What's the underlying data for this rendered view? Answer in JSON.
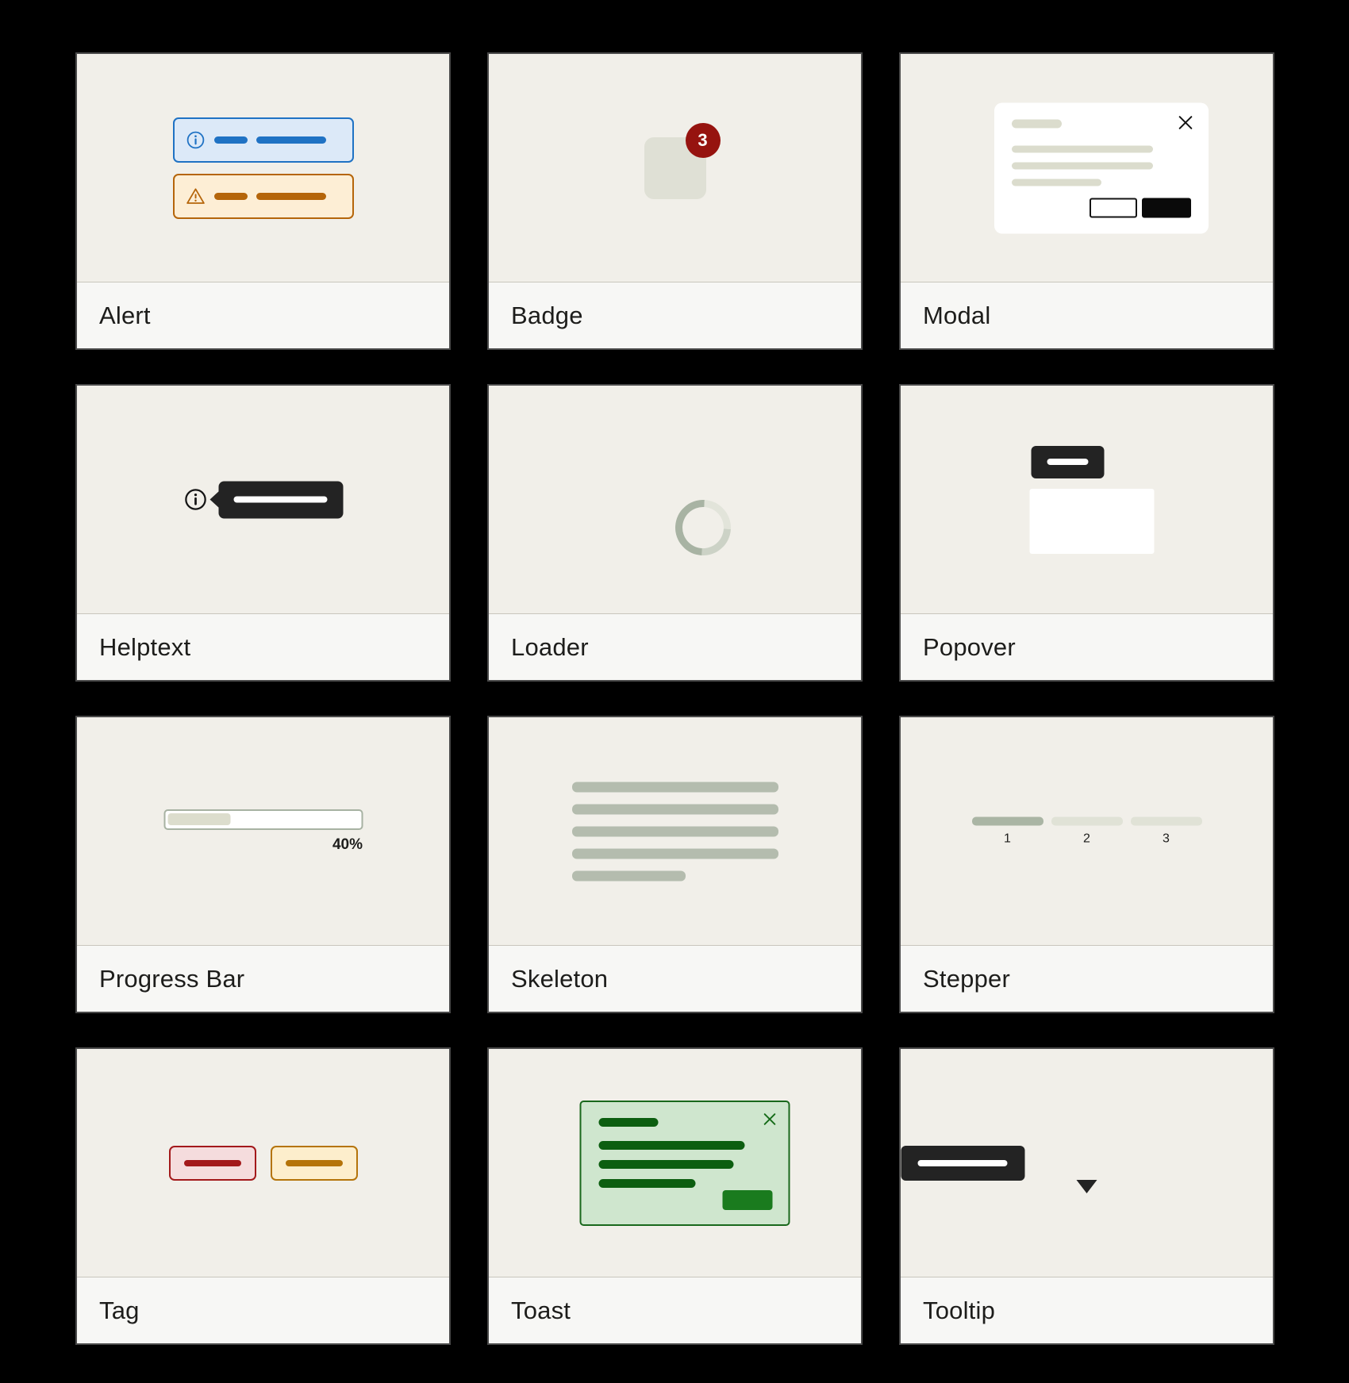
{
  "gallery": {
    "background_color": "#000000",
    "card_border_color": "#4a4a4a",
    "preview_background": "#f1efe9",
    "label_background": "#f7f7f5"
  },
  "cards": [
    {
      "id": "alert",
      "label": "Alert",
      "alerts": [
        {
          "variant": "info",
          "icon": "info-circle-icon",
          "accent": "#1f72c4",
          "fill": "#dce9f8",
          "bars": [
            "short",
            "long"
          ]
        },
        {
          "variant": "warning",
          "icon": "warning-triangle-icon",
          "accent": "#b5650a",
          "fill": "#fdeed5",
          "bars": [
            "short",
            "long"
          ]
        }
      ]
    },
    {
      "id": "badge",
      "label": "Badge",
      "badge": {
        "count": "3",
        "badge_color": "#96130f",
        "badge_text_color": "#ffffff",
        "square_color": "#dfe0d5"
      }
    },
    {
      "id": "modal",
      "label": "Modal",
      "modal": {
        "close_icon": "close-x-icon",
        "panel_color": "#ffffff",
        "skeleton_color": "#dbdccd",
        "buttons": [
          {
            "name": "secondary",
            "style": "outline",
            "color": "#141414"
          },
          {
            "name": "primary",
            "style": "filled",
            "color": "#0a0a0a"
          }
        ]
      }
    },
    {
      "id": "helptext",
      "label": "Helptext",
      "helptext": {
        "icon": "info-circle-icon",
        "bubble_color": "#232323",
        "bar_color": "#ffffff",
        "arrow_direction": "left"
      }
    },
    {
      "id": "loader",
      "label": "Loader",
      "loader": {
        "track_color": "#e2e4da",
        "indicator_color": "#a8b3a3",
        "shape": "ring"
      }
    },
    {
      "id": "popover",
      "label": "Popover",
      "popover": {
        "trigger_color": "#232323",
        "trigger_bar_color": "#ffffff",
        "panel_color": "#ffffff"
      }
    },
    {
      "id": "progress-bar",
      "label": "Progress Bar",
      "progress": {
        "value": 40,
        "value_label": "40%",
        "track_color": "#ffffff",
        "border_color": "#a7b2a2",
        "fill_color": "#dcddcd"
      }
    },
    {
      "id": "skeleton",
      "label": "Skeleton",
      "skeleton": {
        "line_color": "#b4bcae",
        "line_widths": [
          100,
          100,
          100,
          100,
          55
        ]
      }
    },
    {
      "id": "stepper",
      "label": "Stepper",
      "stepper": {
        "active_color": "#aab5a4",
        "inactive_color": "#e0e2d6",
        "steps": [
          {
            "number": "1",
            "state": "done"
          },
          {
            "number": "2",
            "state": "pending"
          },
          {
            "number": "3",
            "state": "pending"
          }
        ]
      }
    },
    {
      "id": "tag",
      "label": "Tag",
      "tags": [
        {
          "variant": "danger",
          "fill": "#f5dcdd",
          "accent": "#a3191b"
        },
        {
          "variant": "warning",
          "fill": "#fdeecc",
          "accent": "#b5740a"
        }
      ]
    },
    {
      "id": "toast",
      "label": "Toast",
      "toast": {
        "variant": "success",
        "fill": "#cfe6ce",
        "border": "#19681c",
        "content_color": "#0c5e10",
        "close_icon": "close-x-icon",
        "action_color": "#1a7b1e"
      }
    },
    {
      "id": "tooltip",
      "label": "Tooltip",
      "tooltip": {
        "body_color": "#232323",
        "bar_color": "#ffffff",
        "arrow_direction": "down"
      }
    }
  ]
}
